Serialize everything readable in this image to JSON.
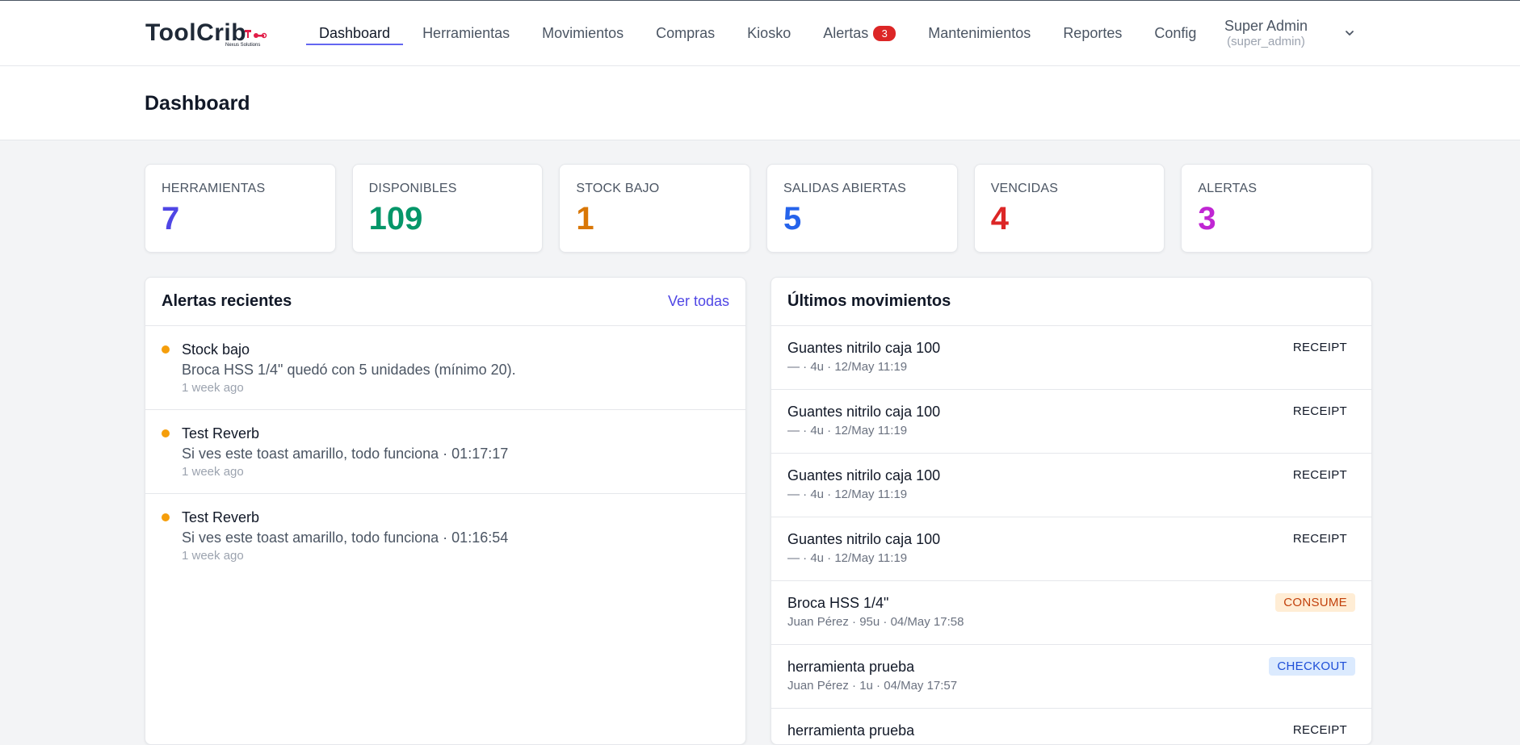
{
  "brand": {
    "name": "ToolCrib",
    "sub": "Nexus Solutions"
  },
  "nav": {
    "items": [
      {
        "label": "Dashboard"
      },
      {
        "label": "Herramientas"
      },
      {
        "label": "Movimientos"
      },
      {
        "label": "Compras"
      },
      {
        "label": "Kiosko"
      },
      {
        "label": "Alertas",
        "badge": "3"
      },
      {
        "label": "Mantenimientos"
      },
      {
        "label": "Reportes"
      },
      {
        "label": "Config"
      }
    ],
    "active": "Dashboard"
  },
  "user": {
    "name": "Super Admin",
    "role": "(super_admin)"
  },
  "page": {
    "title": "Dashboard"
  },
  "stats": [
    {
      "label": "HERRAMIENTAS",
      "value": "7",
      "color": "#4f46e5"
    },
    {
      "label": "DISPONIBLES",
      "value": "109",
      "color": "#059669"
    },
    {
      "label": "STOCK BAJO",
      "value": "1",
      "color": "#d97706"
    },
    {
      "label": "SALIDAS ABIERTAS",
      "value": "5",
      "color": "#2563eb"
    },
    {
      "label": "VENCIDAS",
      "value": "4",
      "color": "#dc2626"
    },
    {
      "label": "ALERTAS",
      "value": "3",
      "color": "#c026d3"
    }
  ],
  "alerts_panel": {
    "title": "Alertas recientes",
    "link": "Ver todas",
    "items": [
      {
        "title": "Stock bajo",
        "message": "Broca HSS 1/4\" quedó con 5 unidades (mínimo 20).",
        "time": "1 week ago"
      },
      {
        "title": "Test Reverb",
        "message": "Si ves este toast amarillo, todo funciona · 01:17:17",
        "time": "1 week ago"
      },
      {
        "title": "Test Reverb",
        "message": "Si ves este toast amarillo, todo funciona · 01:16:54",
        "time": "1 week ago"
      }
    ]
  },
  "moves_panel": {
    "title": "Últimos movimientos",
    "items": [
      {
        "name": "Guantes nitrilo caja 100",
        "meta": "— · 4u · 12/May 11:19",
        "type": "RECEIPT"
      },
      {
        "name": "Guantes nitrilo caja 100",
        "meta": "— · 4u · 12/May 11:19",
        "type": "RECEIPT"
      },
      {
        "name": "Guantes nitrilo caja 100",
        "meta": "— · 4u · 12/May 11:19",
        "type": "RECEIPT"
      },
      {
        "name": "Guantes nitrilo caja 100",
        "meta": "— · 4u · 12/May 11:19",
        "type": "RECEIPT"
      },
      {
        "name": "Broca HSS 1/4\"",
        "meta": "Juan Pérez · 95u · 04/May 17:58",
        "type": "CONSUME"
      },
      {
        "name": "herramienta prueba",
        "meta": "Juan Pérez · 1u · 04/May 17:57",
        "type": "CHECKOUT"
      },
      {
        "name": "herramienta prueba",
        "meta": "",
        "type": "RECEIPT"
      }
    ]
  }
}
